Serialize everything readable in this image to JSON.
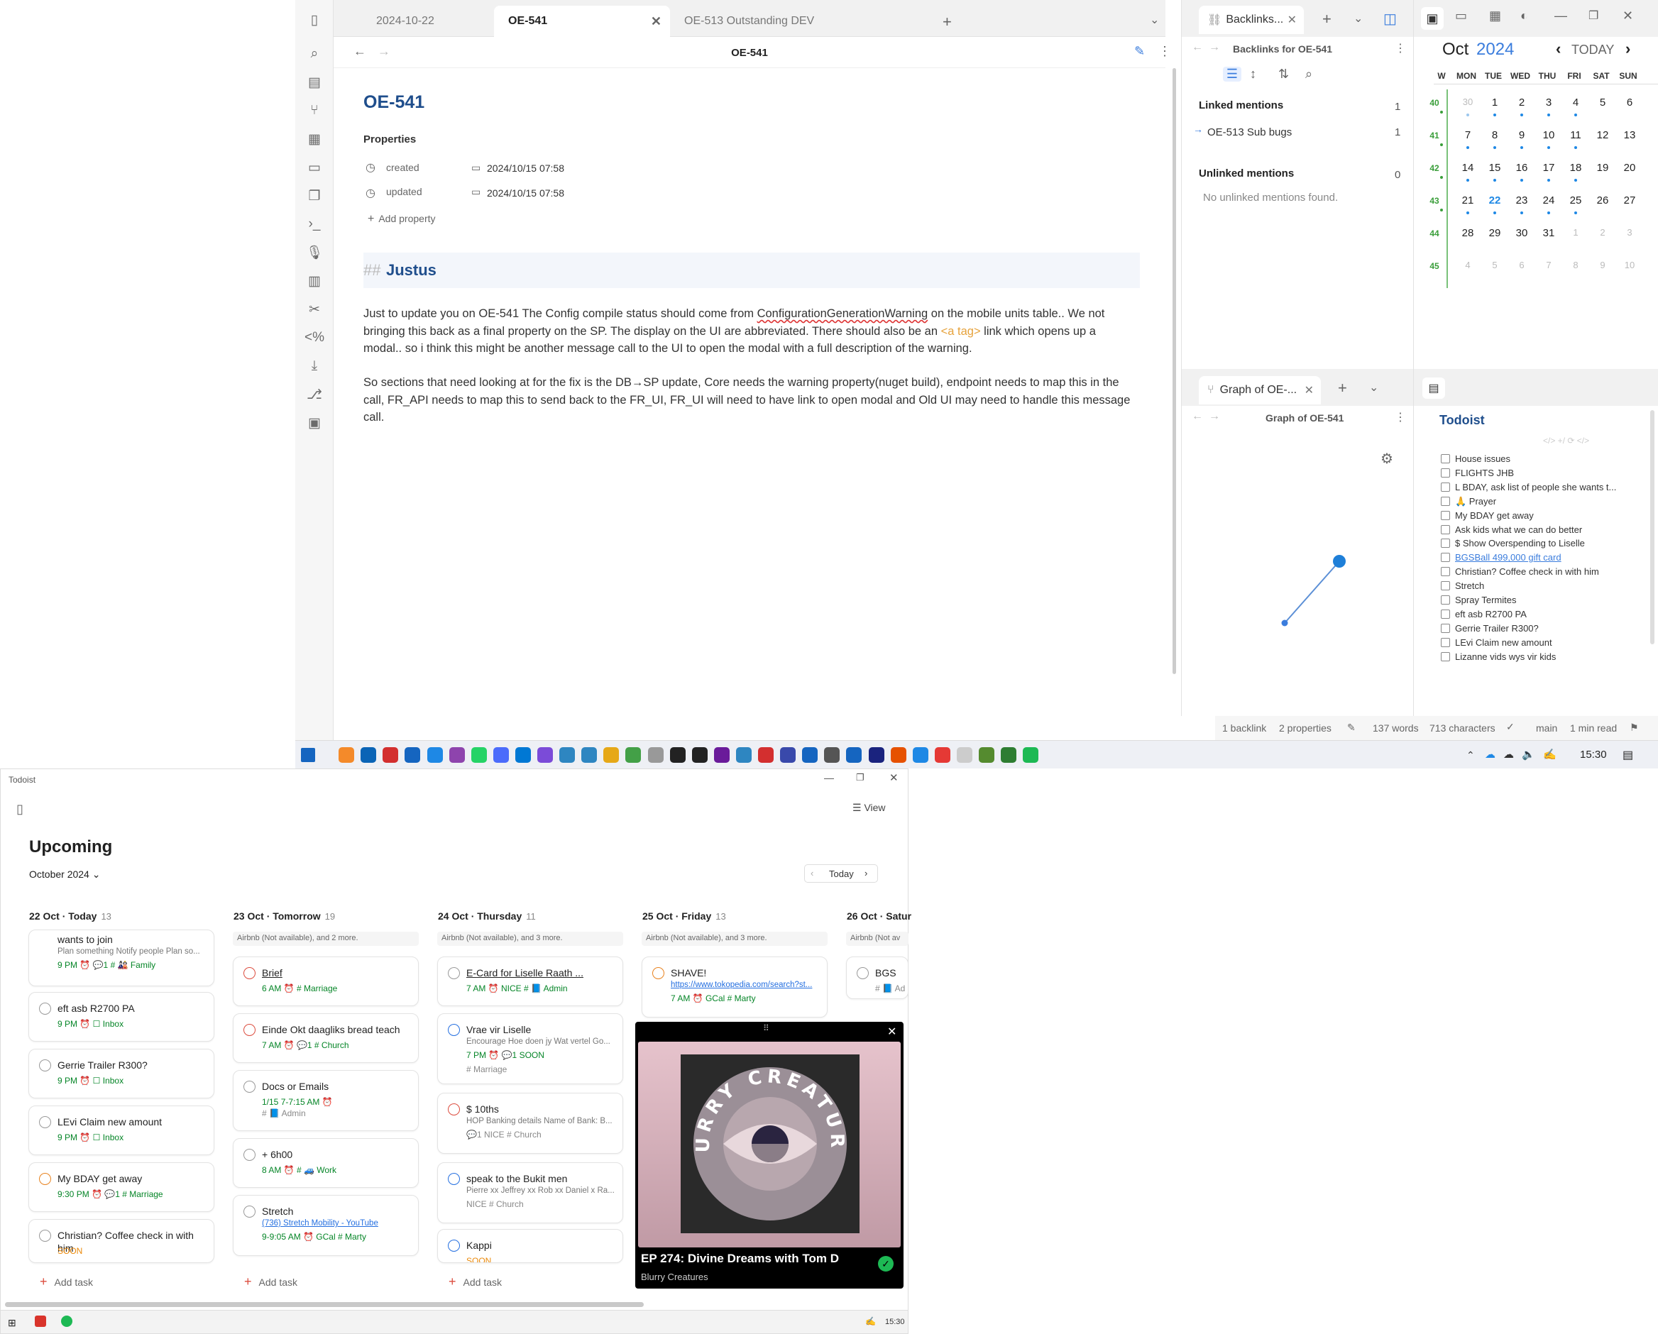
{
  "obsidian": {
    "tabs": [
      "2024-10-22",
      "OE-541",
      "OE-513 Outstanding DEV"
    ],
    "nav_title": "OE-541",
    "note_title": "OE-541",
    "properties_label": "Properties",
    "props": [
      {
        "key": "created",
        "value": "2024/10/15  07:58"
      },
      {
        "key": "updated",
        "value": "2024/10/15  07:58"
      }
    ],
    "add_property": "Add property",
    "heading_marker": "##",
    "heading": "Justus",
    "para1a": "Just to update you on OE-541 The Config compile status should come from ",
    "para1_link": "ConfigurationGenerationWarning",
    "para1b": " on the mobile units table.. We not bringing this back as a final property on the SP.  The display on the UI are abbreviated. There should also be an ",
    "para1_tag": "<a tag>",
    "para1c": " link which opens up a modal.. so i think this might be another message call to the UI to open the modal with a full description of the warning.",
    "para2": "So sections that need looking at for the fix is the DB→SP update, Core needs the warning property(nuget build), endpoint needs to map this in the call, FR_API needs to map this to send back to the FR_UI, FR_UI will need to have link to open modal and Old UI may need to handle this message call.",
    "backlinks": {
      "tab": "Backlinks...",
      "title": "Backlinks for OE-541",
      "linked": "Linked mentions",
      "linked_count": "1",
      "item": "OE-513 Sub bugs",
      "item_count": "1",
      "unlinked": "Unlinked mentions",
      "unlinked_count": "0",
      "none": "No unlinked mentions found."
    },
    "graph": {
      "tab": "Graph of OE-...",
      "title": "Graph of OE-541"
    },
    "calendar": {
      "month": "Oct",
      "year": "2024",
      "today": "TODAY",
      "w": "W",
      "days": [
        "MON",
        "TUE",
        "WED",
        "THU",
        "FRI",
        "SAT",
        "SUN"
      ],
      "weeks": [
        {
          "w": "40",
          "d": [
            "30",
            "1",
            "2",
            "3",
            "4",
            "5",
            "6"
          ]
        },
        {
          "w": "41",
          "d": [
            "7",
            "8",
            "9",
            "10",
            "11",
            "12",
            "13"
          ]
        },
        {
          "w": "42",
          "d": [
            "14",
            "15",
            "16",
            "17",
            "18",
            "19",
            "20"
          ]
        },
        {
          "w": "43",
          "d": [
            "21",
            "22",
            "23",
            "24",
            "25",
            "26",
            "27"
          ]
        },
        {
          "w": "44",
          "d": [
            "28",
            "29",
            "30",
            "31",
            "1",
            "2",
            "3"
          ]
        },
        {
          "w": "45",
          "d": [
            "4",
            "5",
            "6",
            "7",
            "8",
            "9",
            "10"
          ]
        }
      ]
    },
    "todoist_plugin": {
      "title": "Todoist",
      "items": [
        "House issues",
        "FLIGHTS JHB",
        "L BDAY, ask list of people she wants t...",
        "🙏 Prayer",
        "My BDAY get away",
        "Ask kids what we can do better",
        "$ Show Overspending to Liselle",
        "BGSBall 499,000 gift card",
        "Christian? Coffee check in with him",
        "Stretch",
        "Spray Termites",
        "eft asb R2700 PA",
        "Gerrie Trailer R300?",
        "LEvi Claim new amount",
        "Lizanne vids wys vir kids"
      ]
    },
    "status": {
      "backlink": "1 backlink",
      "props": "2 properties",
      "words": "137 words",
      "chars": "713 characters",
      "branch": "main",
      "read": "1 min read"
    }
  },
  "taskbar": {
    "time": "15:30"
  },
  "todoist": {
    "window_title": "Todoist",
    "view": "View",
    "page_title": "Upcoming",
    "month": "October 2024",
    "today_btn": "Today",
    "add_task": "Add task",
    "columns": [
      {
        "head": "22 Oct · Today",
        "count": "13"
      },
      {
        "head": "23 Oct · Tomorrow",
        "count": "19",
        "bar": "Airbnb (Not available), and 2 more."
      },
      {
        "head": "24 Oct · Thursday",
        "count": "11",
        "bar": "Airbnb (Not available), and 3 more."
      },
      {
        "head": "25 Oct · Friday",
        "count": "13",
        "bar": "Airbnb (Not available), and 3 more."
      },
      {
        "head": "26 Oct · Satur",
        "count": "",
        "bar": "Airbnb (Not av"
      }
    ],
    "c1": [
      {
        "t": "wants to join",
        "s": "Plan something Notify people Plan so...",
        "m": "9 PM   ⏰  💬1  # 🎎 Family"
      },
      {
        "t": "eft asb R2700 PA",
        "m": "9 PM   ⏰  ☐ Inbox"
      },
      {
        "t": "Gerrie Trailer R300?",
        "m": "9 PM   ⏰  ☐ Inbox"
      },
      {
        "t": "LEvi Claim new amount",
        "m": "9 PM   ⏰  ☐ Inbox"
      },
      {
        "t": "My BDAY get away",
        "m": "9:30 PM   ⏰  💬1  # Marriage"
      },
      {
        "t": "Christian? Coffee check in with him",
        "m": "SOON"
      }
    ],
    "c2": [
      {
        "t": "Brief",
        "m": "6 AM   ⏰  # Marriage"
      },
      {
        "t": "Einde Okt daagliks bread teach",
        "m": "7 AM   ⏰  💬1  # Church"
      },
      {
        "t": "Docs or Emails",
        "m": "1/15   7-7:15 AM   ⏰",
        "m2": "# 📘 Admin"
      },
      {
        "t": "+ 6h00",
        "m": "8 AM   ⏰  # 🚙 Work"
      },
      {
        "t": "Stretch",
        "s": "(736) Stretch Mobility - YouTube",
        "m": "9-9:05 AM   ⏰  GCal  # Marty"
      }
    ],
    "c3": [
      {
        "t": "E-Card for Liselle Raath ...",
        "m": "7 AM   ⏰  NICE  # 📘 Admin"
      },
      {
        "t": "Vrae vir Liselle",
        "s": "Encourage Hoe doen jy Wat vertel Go...",
        "m": "7 PM   ⏰  💬1  SOON",
        "m2": "# Marriage"
      },
      {
        "t": "$ 10ths",
        "s": "HOP Banking details Name of Bank: B...",
        "m": "💬1  NICE  # Church"
      },
      {
        "t": "speak to the Bukit men",
        "s": "Pierre xx Jeffrey xx Rob xx Daniel x Ra...",
        "m": "NICE  # Church"
      },
      {
        "t": "Kappi",
        "m": "SOON"
      }
    ],
    "c4": [
      {
        "t": "SHAVE!",
        "s": "https://www.tokopedia.com/search?st...",
        "m": "7 AM   ⏰  GCal  # Marty"
      }
    ],
    "c5": [
      {
        "t": "BGS",
        "m": "# 📘 Ad"
      }
    ]
  },
  "spotify": {
    "title": "EP 274: Divine Dreams with Tom D",
    "show": "Blurry Creatures",
    "art_text": "BLURRY CREATURES"
  },
  "taskbar2": {
    "time": "15:30"
  }
}
